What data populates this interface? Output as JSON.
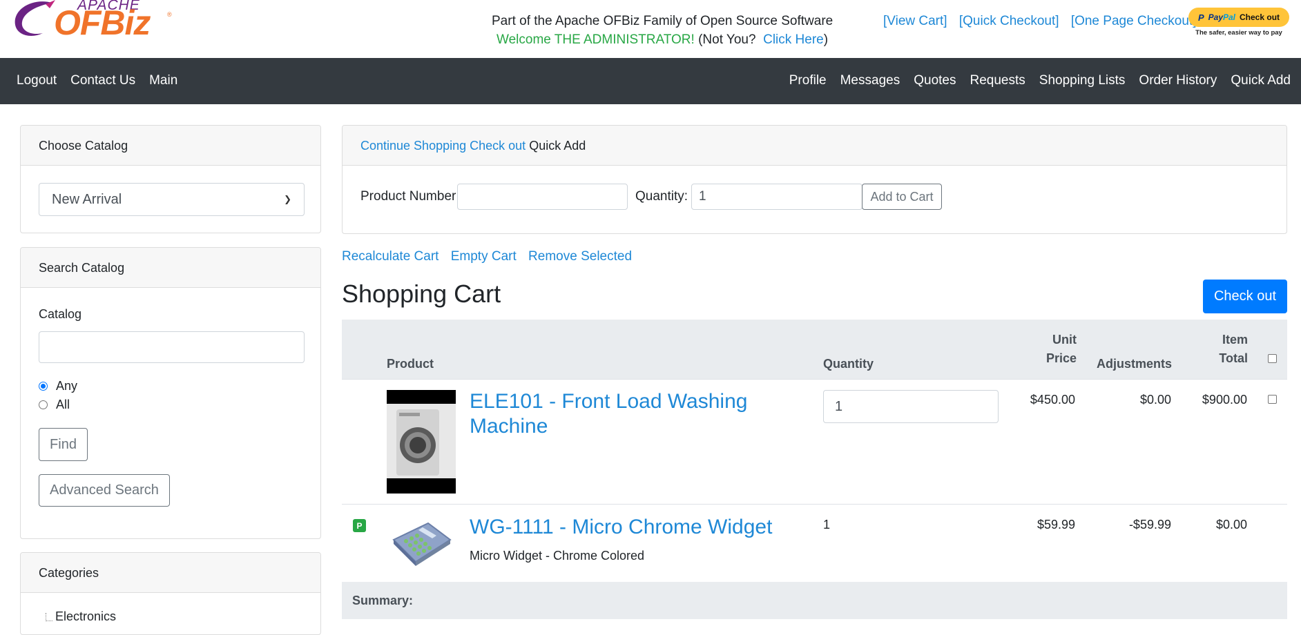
{
  "header": {
    "logo_apache": "APACHE",
    "logo_ofbiz": "OFBiz",
    "logo_reg": "®",
    "family_text": "Part of the Apache OFBiz Family of Open Source Software",
    "welcome_text": "Welcome THE ADMINISTRATOR!",
    "not_you_text": " (Not You?  ",
    "click_here": "Click Here",
    "close_paren": ")",
    "links": [
      "[View Cart]",
      "[Quick Checkout]",
      "[One Page Checkout]"
    ],
    "paypal": {
      "p": "P",
      "pay": "Pay",
      "pal": "Pal",
      "checkout": "Check out",
      "tagline": "The safer, easier way to pay"
    }
  },
  "nav": {
    "left": [
      "Logout",
      "Contact Us",
      "Main"
    ],
    "right": [
      "Profile",
      "Messages",
      "Quotes",
      "Requests",
      "Shopping Lists",
      "Order History",
      "Quick Add"
    ]
  },
  "sidebar": {
    "choose_catalog": {
      "title": "Choose Catalog",
      "selected": "New Arrival"
    },
    "search_catalog": {
      "title": "Search Catalog",
      "catalog_label": "Catalog",
      "catalog_value": "",
      "radio_any": "Any",
      "radio_all": "All",
      "find_button": "Find",
      "advanced_button": "Advanced Search"
    },
    "categories": {
      "title": "Categories",
      "items": [
        "Electronics"
      ]
    }
  },
  "quick_add": {
    "continue_shopping": "Continue Shopping",
    "check_out": "Check out",
    "title": "Quick Add",
    "product_number_label": "Product Number",
    "product_number_value": "",
    "quantity_label": "Quantity:",
    "quantity_value": "1",
    "add_to_cart": "Add to Cart"
  },
  "cart_actions": [
    "Recalculate Cart",
    "Empty Cart",
    "Remove Selected"
  ],
  "cart": {
    "title": "Shopping Cart",
    "checkout_button": "Check out",
    "headers": {
      "product": "Product",
      "quantity": "Quantity",
      "unit_price_1": "Unit",
      "unit_price_2": "Price",
      "adjustments": "Adjustments",
      "item_total_1": "Item",
      "item_total_2": "Total"
    },
    "rows": [
      {
        "product_line1": "ELE101 - Front Load Washing",
        "product_line2": "Machine",
        "quantity": "1",
        "unit_price": "$450.00",
        "adjustments": "$0.00",
        "item_total": "$900.00"
      },
      {
        "badge": "P",
        "product": "WG-1111 - Micro Chrome Widget",
        "description": "Micro Widget - Chrome Colored",
        "quantity": "1",
        "unit_price": "$59.99",
        "adjustments": "-$59.99",
        "item_total": "$0.00"
      }
    ],
    "summary_label": "Summary:"
  },
  "colors": {
    "link": "#1e88d6",
    "navbar": "#343a40",
    "primary": "#007bff",
    "welcome": "#28a745",
    "logo_orange": "#f0732a",
    "logo_purple": "#6b2384"
  }
}
